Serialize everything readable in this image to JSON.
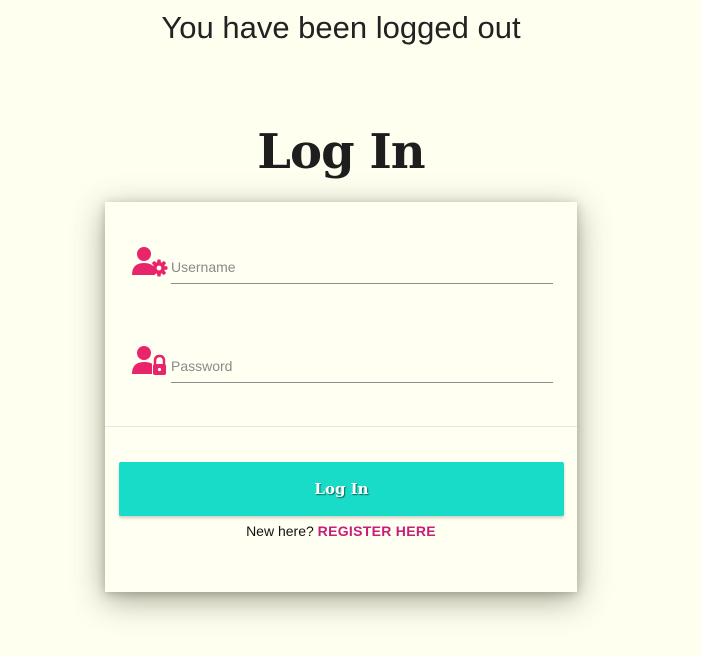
{
  "header": {
    "logout_message": "You have been logged out",
    "title": "Log In"
  },
  "form": {
    "username": {
      "placeholder": "Username",
      "value": "",
      "icon": "user-gear-icon"
    },
    "password": {
      "placeholder": "Password",
      "value": "",
      "icon": "user-lock-icon"
    },
    "submit_label": "Log In",
    "register_prompt": "New here?",
    "register_link": "REGISTER HERE"
  },
  "colors": {
    "background": "#fffff0",
    "accent_icon": "#e8246a",
    "button": "#19dcc8",
    "link": "#c81e7a"
  }
}
